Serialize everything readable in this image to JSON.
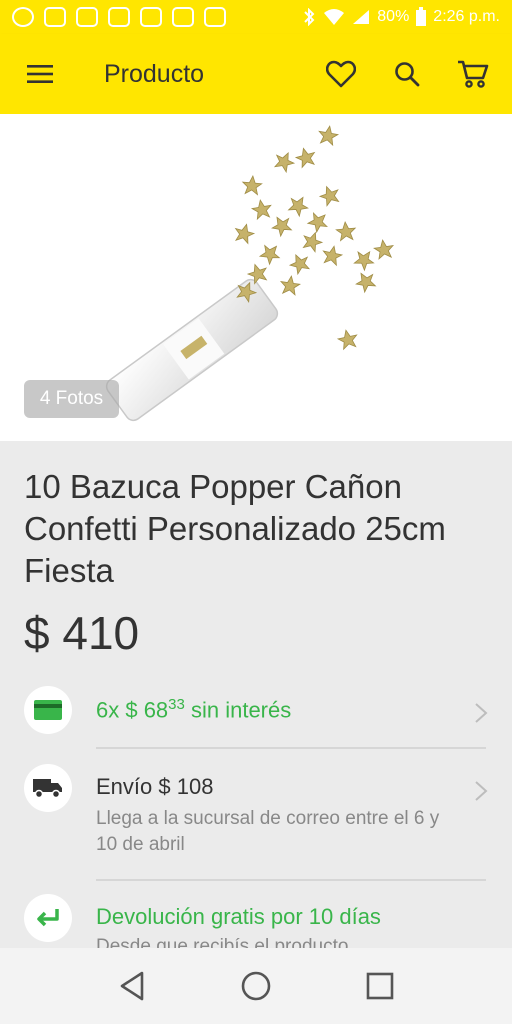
{
  "status_bar": {
    "battery": "80%",
    "time": "2:26 p.m."
  },
  "header": {
    "title": "Producto"
  },
  "gallery": {
    "photos_label": "4 Fotos"
  },
  "product": {
    "title": "10 Bazuca Popper Cañon Confetti Personalizado 25cm Fiesta",
    "price": "$ 410",
    "installments_prefix": "6x $ 68",
    "installments_cents": "33",
    "installments_suffix": " sin interés",
    "shipping_label": "Envío $ 108",
    "shipping_detail": "Llega a la sucursal de correo entre el 6 y 10 de abril",
    "returns_label": "Devolución gratis por 10 días",
    "returns_detail": "Desde que recibís el producto"
  },
  "colors": {
    "brand_yellow": "#ffe600",
    "accent_green": "#39b54a",
    "text_dark": "#333333"
  }
}
